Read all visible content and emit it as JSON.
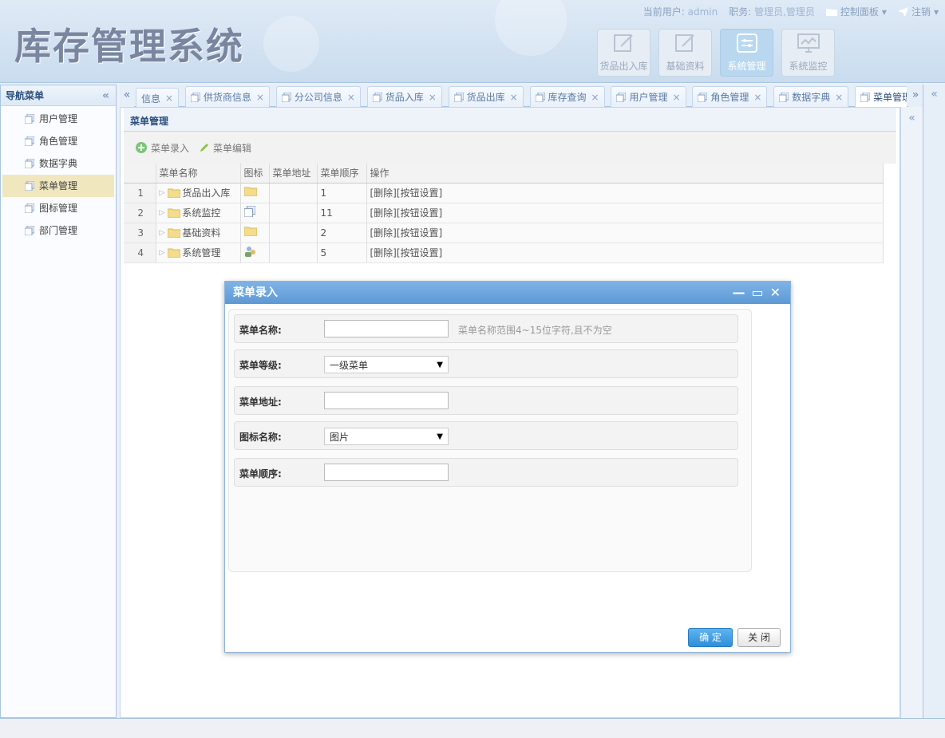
{
  "app": {
    "title": "库存管理系统"
  },
  "topbar": {
    "user_label": "当前用户:",
    "user_value": "admin",
    "role_label": "职务:",
    "role_value": "管理员,管理员",
    "control_panel": "控制面板",
    "logout": "注销"
  },
  "modules": [
    {
      "label": "货品出入库"
    },
    {
      "label": "基础资料"
    },
    {
      "label": "系统管理"
    },
    {
      "label": "系统监控"
    }
  ],
  "sidebar": {
    "title": "导航菜单",
    "items": [
      {
        "label": "用户管理"
      },
      {
        "label": "角色管理"
      },
      {
        "label": "数据字典"
      },
      {
        "label": "菜单管理"
      },
      {
        "label": "图标管理"
      },
      {
        "label": "部门管理"
      }
    ]
  },
  "tabs": [
    {
      "label": "信息"
    },
    {
      "label": "供货商信息"
    },
    {
      "label": "分公司信息"
    },
    {
      "label": "货品入库"
    },
    {
      "label": "货品出库"
    },
    {
      "label": "库存查询"
    },
    {
      "label": "用户管理"
    },
    {
      "label": "角色管理"
    },
    {
      "label": "数据字典"
    },
    {
      "label": "菜单管理"
    }
  ],
  "main": {
    "title": "菜单管理",
    "toolbar": {
      "add": "菜单录入",
      "edit": "菜单编辑"
    },
    "columns": [
      "菜单名称",
      "图标",
      "菜单地址",
      "菜单顺序",
      "操作"
    ],
    "rows": [
      {
        "num": "1",
        "name": "货品出入库",
        "addr": "",
        "order": "1",
        "ops": "[删除][按钮设置]"
      },
      {
        "num": "2",
        "name": "系统监控",
        "addr": "",
        "order": "11",
        "ops": "[删除][按钮设置]"
      },
      {
        "num": "3",
        "name": "基础资料",
        "addr": "",
        "order": "2",
        "ops": "[删除][按钮设置]"
      },
      {
        "num": "4",
        "name": "系统管理",
        "addr": "",
        "order": "5",
        "ops": "[删除][按钮设置]"
      }
    ]
  },
  "dialog": {
    "title": "菜单录入",
    "name_label": "菜单名称:",
    "name_value": "",
    "name_hint": "菜单名称范围4~15位字符,且不为空",
    "level_label": "菜单等级:",
    "level_value": "一级菜单",
    "addr_label": "菜单地址:",
    "addr_value": "",
    "icon_label": "图标名称:",
    "icon_value": "图片",
    "order_label": "菜单顺序:",
    "order_value": "",
    "ok": "确 定",
    "close": "关 闭"
  }
}
